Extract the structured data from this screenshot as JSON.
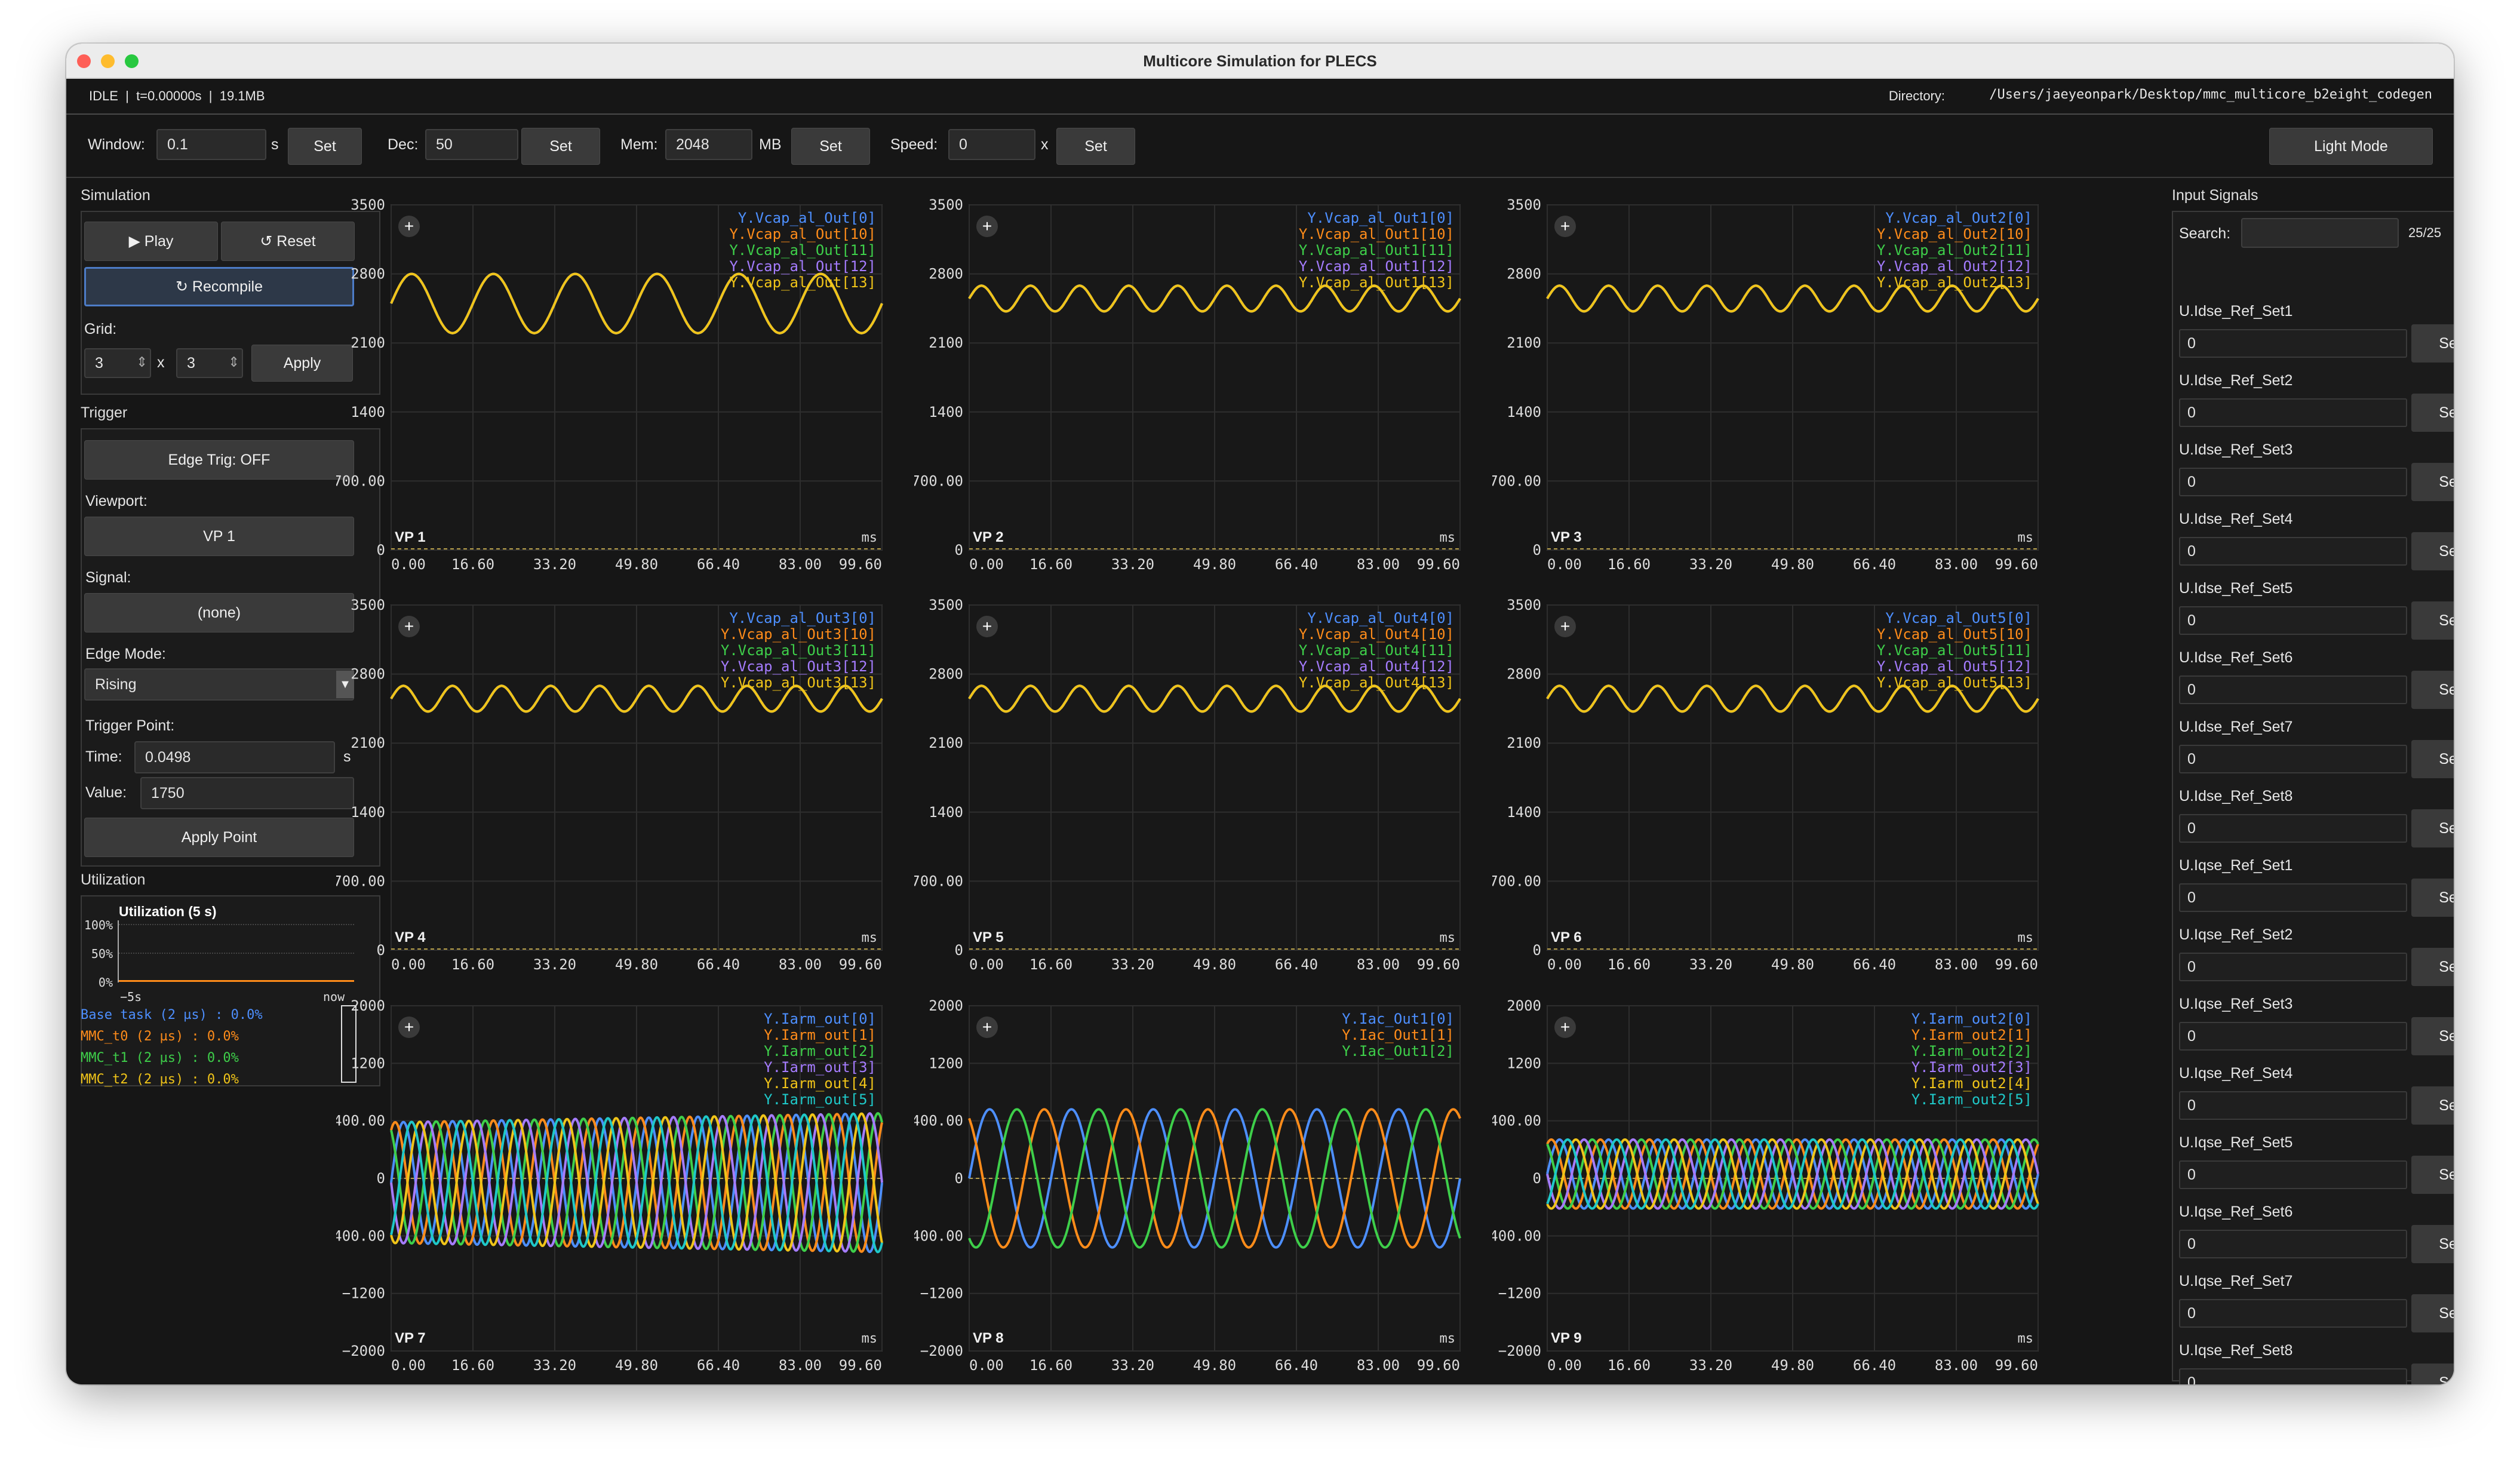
{
  "window": {
    "title": "Multicore Simulation for PLECS"
  },
  "status": {
    "text": "IDLE  |  t=0.00000s  |  19.1MB",
    "directory_label": "Directory:",
    "directory_path": "/Users/jaeyeonpark/Desktop/mmc_multicore_b2eight_codegen"
  },
  "toolbar": {
    "window_label": "Window:",
    "window_value": "0.1",
    "window_unit": "s",
    "dec_label": "Dec:",
    "dec_value": "50",
    "mem_label": "Mem:",
    "mem_value": "2048",
    "mem_unit": "MB",
    "speed_label": "Speed:",
    "speed_value": "0",
    "speed_unit": "x",
    "set_label": "Set",
    "light_mode_label": "Light Mode"
  },
  "simulation": {
    "title": "Simulation",
    "play_label": "▶  Play",
    "reset_label": "↺  Reset",
    "recompile_label": "↻  Recompile",
    "grid_label": "Grid:",
    "grid_rows": "3",
    "grid_x": "x",
    "grid_cols": "3",
    "apply_label": "Apply"
  },
  "trigger": {
    "title": "Trigger",
    "edge_trig_label": "Edge Trig: OFF",
    "viewport_label": "Viewport:",
    "viewport_value": "VP 1",
    "signal_label": "Signal:",
    "signal_value": "(none)",
    "edge_mode_label": "Edge Mode:",
    "edge_mode_value": "Rising",
    "trigger_point_label": "Trigger Point:",
    "time_label": "Time:",
    "time_value": "0.0498",
    "time_unit": "s",
    "value_label": "Value:",
    "value_value": "1750",
    "apply_point_label": "Apply Point"
  },
  "utilization": {
    "title": "Utilization",
    "chart_title": "Utilization (5 s)",
    "y_ticks": [
      "100%",
      "50%",
      "0%"
    ],
    "x_start": "−5s",
    "x_end": "now",
    "tasks": [
      {
        "label": "Base task (2 µs) : 0.0%",
        "color": "#4d8fff"
      },
      {
        "label": "MMC_t0 (2 µs) : 0.0%",
        "color": "#ff8c1a"
      },
      {
        "label": "MMC_t1 (2 µs) : 0.0%",
        "color": "#3ecf4a"
      },
      {
        "label": "MMC_t2 (2 µs) : 0.0%",
        "color": "#f0c419"
      }
    ]
  },
  "input_signals": {
    "title": "Input Signals",
    "search_label": "Search:",
    "search_value": "",
    "count": "25/25",
    "set_label": "Set",
    "items": [
      {
        "name": "U.Idse_Ref_Set1",
        "value": "0"
      },
      {
        "name": "U.Idse_Ref_Set2",
        "value": "0"
      },
      {
        "name": "U.Idse_Ref_Set3",
        "value": "0"
      },
      {
        "name": "U.Idse_Ref_Set4",
        "value": "0"
      },
      {
        "name": "U.Idse_Ref_Set5",
        "value": "0"
      },
      {
        "name": "U.Idse_Ref_Set6",
        "value": "0"
      },
      {
        "name": "U.Idse_Ref_Set7",
        "value": "0"
      },
      {
        "name": "U.Idse_Ref_Set8",
        "value": "0"
      },
      {
        "name": "U.Iqse_Ref_Set1",
        "value": "0"
      },
      {
        "name": "U.Iqse_Ref_Set2",
        "value": "0"
      },
      {
        "name": "U.Iqse_Ref_Set3",
        "value": "0"
      },
      {
        "name": "U.Iqse_Ref_Set4",
        "value": "0"
      },
      {
        "name": "U.Iqse_Ref_Set5",
        "value": "0"
      },
      {
        "name": "U.Iqse_Ref_Set6",
        "value": "0"
      },
      {
        "name": "U.Iqse_Ref_Set7",
        "value": "0"
      },
      {
        "name": "U.Iqse_Ref_Set8",
        "value": "0"
      }
    ]
  },
  "colors": {
    "blue": "#4d8fff",
    "orange": "#ff8c1a",
    "green": "#3ecf4a",
    "purple": "#a57cff",
    "yellow": "#f0c419",
    "cyan": "#1fc8c8"
  },
  "chart_data": [
    {
      "type": "line",
      "viewport": "VP 1",
      "x_unit": "ms",
      "xlim": [
        0,
        99.6
      ],
      "ylim": [
        0,
        3500
      ],
      "x_ticks": [
        "0.00",
        "16.60",
        "33.20",
        "49.80",
        "66.40",
        "83.00",
        "99.60"
      ],
      "y_ticks": [
        "3500",
        "2800",
        "2100",
        "1400",
        "700.00",
        "0"
      ],
      "series": [
        {
          "name": "Y.Vcap_al_Out[0]",
          "color": "#4d8fff",
          "center": 2500,
          "amplitude": 300,
          "cycles": 6
        },
        {
          "name": "Y.Vcap_al_Out[10]",
          "color": "#ff8c1a",
          "center": 2500,
          "amplitude": 300,
          "cycles": 6
        },
        {
          "name": "Y.Vcap_al_Out[11]",
          "color": "#3ecf4a",
          "center": 2500,
          "amplitude": 300,
          "cycles": 6
        },
        {
          "name": "Y.Vcap_al_Out[12]",
          "color": "#a57cff",
          "center": 2500,
          "amplitude": 300,
          "cycles": 6
        },
        {
          "name": "Y.Vcap_al_Out[13]",
          "color": "#f0c419",
          "center": 2500,
          "amplitude": 300,
          "cycles": 6
        }
      ]
    },
    {
      "type": "line",
      "viewport": "VP 2",
      "x_unit": "ms",
      "xlim": [
        0,
        99.6
      ],
      "ylim": [
        0,
        3500
      ],
      "x_ticks": [
        "0.00",
        "16.60",
        "33.20",
        "49.80",
        "66.40",
        "83.00",
        "99.60"
      ],
      "y_ticks": [
        "3500",
        "2800",
        "2100",
        "1400",
        "700.00",
        "0"
      ],
      "series": [
        {
          "name": "Y.Vcap_al_Out1[0]",
          "color": "#4d8fff",
          "center": 2550,
          "amplitude": 130,
          "cycles": 10
        },
        {
          "name": "Y.Vcap_al_Out1[10]",
          "color": "#ff8c1a",
          "center": 2550,
          "amplitude": 130,
          "cycles": 10
        },
        {
          "name": "Y.Vcap_al_Out1[11]",
          "color": "#3ecf4a",
          "center": 2550,
          "amplitude": 130,
          "cycles": 10
        },
        {
          "name": "Y.Vcap_al_Out1[12]",
          "color": "#a57cff",
          "center": 2550,
          "amplitude": 130,
          "cycles": 10
        },
        {
          "name": "Y.Vcap_al_Out1[13]",
          "color": "#f0c419",
          "center": 2550,
          "amplitude": 130,
          "cycles": 10
        }
      ]
    },
    {
      "type": "line",
      "viewport": "VP 3",
      "x_unit": "ms",
      "xlim": [
        0,
        99.6
      ],
      "ylim": [
        0,
        3500
      ],
      "x_ticks": [
        "0.00",
        "16.60",
        "33.20",
        "49.80",
        "66.40",
        "83.00",
        "99.60"
      ],
      "y_ticks": [
        "3500",
        "2800",
        "2100",
        "1400",
        "700.00",
        "0"
      ],
      "series": [
        {
          "name": "Y.Vcap_al_Out2[0]",
          "color": "#4d8fff",
          "center": 2550,
          "amplitude": 130,
          "cycles": 10
        },
        {
          "name": "Y.Vcap_al_Out2[10]",
          "color": "#ff8c1a",
          "center": 2550,
          "amplitude": 130,
          "cycles": 10
        },
        {
          "name": "Y.Vcap_al_Out2[11]",
          "color": "#3ecf4a",
          "center": 2550,
          "amplitude": 130,
          "cycles": 10
        },
        {
          "name": "Y.Vcap_al_Out2[12]",
          "color": "#a57cff",
          "center": 2550,
          "amplitude": 130,
          "cycles": 10
        },
        {
          "name": "Y.Vcap_al_Out2[13]",
          "color": "#f0c419",
          "center": 2550,
          "amplitude": 130,
          "cycles": 10
        }
      ]
    },
    {
      "type": "line",
      "viewport": "VP 4",
      "x_unit": "ms",
      "xlim": [
        0,
        99.6
      ],
      "ylim": [
        0,
        3500
      ],
      "x_ticks": [
        "0.00",
        "16.60",
        "33.20",
        "49.80",
        "66.40",
        "83.00",
        "99.60"
      ],
      "y_ticks": [
        "3500",
        "2800",
        "2100",
        "1400",
        "700.00",
        "0"
      ],
      "series": [
        {
          "name": "Y.Vcap_al_Out3[0]",
          "color": "#4d8fff",
          "center": 2550,
          "amplitude": 130,
          "cycles": 10
        },
        {
          "name": "Y.Vcap_al_Out3[10]",
          "color": "#ff8c1a",
          "center": 2550,
          "amplitude": 130,
          "cycles": 10
        },
        {
          "name": "Y.Vcap_al_Out3[11]",
          "color": "#3ecf4a",
          "center": 2550,
          "amplitude": 130,
          "cycles": 10
        },
        {
          "name": "Y.Vcap_al_Out3[12]",
          "color": "#a57cff",
          "center": 2550,
          "amplitude": 130,
          "cycles": 10
        },
        {
          "name": "Y.Vcap_al_Out3[13]",
          "color": "#f0c419",
          "center": 2550,
          "amplitude": 130,
          "cycles": 10
        }
      ]
    },
    {
      "type": "line",
      "viewport": "VP 5",
      "x_unit": "ms",
      "xlim": [
        0,
        99.6
      ],
      "ylim": [
        0,
        3500
      ],
      "x_ticks": [
        "0.00",
        "16.60",
        "33.20",
        "49.80",
        "66.40",
        "83.00",
        "99.60"
      ],
      "y_ticks": [
        "3500",
        "2800",
        "2100",
        "1400",
        "700.00",
        "0"
      ],
      "series": [
        {
          "name": "Y.Vcap_al_Out4[0]",
          "color": "#4d8fff",
          "center": 2550,
          "amplitude": 130,
          "cycles": 10
        },
        {
          "name": "Y.Vcap_al_Out4[10]",
          "color": "#ff8c1a",
          "center": 2550,
          "amplitude": 130,
          "cycles": 10
        },
        {
          "name": "Y.Vcap_al_Out4[11]",
          "color": "#3ecf4a",
          "center": 2550,
          "amplitude": 130,
          "cycles": 10
        },
        {
          "name": "Y.Vcap_al_Out4[12]",
          "color": "#a57cff",
          "center": 2550,
          "amplitude": 130,
          "cycles": 10
        },
        {
          "name": "Y.Vcap_al_Out4[13]",
          "color": "#f0c419",
          "center": 2550,
          "amplitude": 130,
          "cycles": 10
        }
      ]
    },
    {
      "type": "line",
      "viewport": "VP 6",
      "x_unit": "ms",
      "xlim": [
        0,
        99.6
      ],
      "ylim": [
        0,
        3500
      ],
      "x_ticks": [
        "0.00",
        "16.60",
        "33.20",
        "49.80",
        "66.40",
        "83.00",
        "99.60"
      ],
      "y_ticks": [
        "3500",
        "2800",
        "2100",
        "1400",
        "700.00",
        "0"
      ],
      "series": [
        {
          "name": "Y.Vcap_al_Out5[0]",
          "color": "#4d8fff",
          "center": 2550,
          "amplitude": 130,
          "cycles": 10
        },
        {
          "name": "Y.Vcap_al_Out5[10]",
          "color": "#ff8c1a",
          "center": 2550,
          "amplitude": 130,
          "cycles": 10
        },
        {
          "name": "Y.Vcap_al_Out5[11]",
          "color": "#3ecf4a",
          "center": 2550,
          "amplitude": 130,
          "cycles": 10
        },
        {
          "name": "Y.Vcap_al_Out5[12]",
          "color": "#a57cff",
          "center": 2550,
          "amplitude": 130,
          "cycles": 10
        },
        {
          "name": "Y.Vcap_al_Out5[13]",
          "color": "#f0c419",
          "center": 2550,
          "amplitude": 130,
          "cycles": 10
        }
      ]
    },
    {
      "type": "line",
      "viewport": "VP 7",
      "x_unit": "ms",
      "xlim": [
        0,
        99.6
      ],
      "ylim": [
        -2000,
        2000
      ],
      "x_ticks": [
        "0.00",
        "16.60",
        "33.20",
        "49.80",
        "66.40",
        "83.00",
        "99.60"
      ],
      "y_ticks": [
        "2000",
        "1200",
        "400.00",
        "0",
        "−400.00",
        "−1200",
        "−2000"
      ],
      "series": [
        {
          "name": "Y.Iarm_out[0]",
          "color": "#4d8fff",
          "center": -50,
          "amplitude": 700,
          "cycles": 10,
          "phase": 0
        },
        {
          "name": "Y.Iarm_out[1]",
          "color": "#ff8c1a",
          "center": -50,
          "amplitude": 700,
          "cycles": 10,
          "phase": 1.05
        },
        {
          "name": "Y.Iarm_out[2]",
          "color": "#3ecf4a",
          "center": -50,
          "amplitude": 700,
          "cycles": 10,
          "phase": 2.09
        },
        {
          "name": "Y.Iarm_out[3]",
          "color": "#a57cff",
          "center": -50,
          "amplitude": 700,
          "cycles": 10,
          "phase": 3.14
        },
        {
          "name": "Y.Iarm_out[4]",
          "color": "#f0c419",
          "center": -50,
          "amplitude": 700,
          "cycles": 10,
          "phase": 4.19
        },
        {
          "name": "Y.Iarm_out[5]",
          "color": "#1fc8c8",
          "center": -50,
          "amplitude": 700,
          "cycles": 10,
          "phase": 5.24
        }
      ]
    },
    {
      "type": "line",
      "viewport": "VP 8",
      "x_unit": "ms",
      "xlim": [
        0,
        99.6
      ],
      "ylim": [
        -2000,
        2000
      ],
      "x_ticks": [
        "0.00",
        "16.60",
        "33.20",
        "49.80",
        "66.40",
        "83.00",
        "99.60"
      ],
      "y_ticks": [
        "2000",
        "1200",
        "400.00",
        "0",
        "−400.00",
        "−1200",
        "−2000"
      ],
      "series": [
        {
          "name": "Y.Iac_Out1[0]",
          "color": "#4d8fff",
          "center": 0,
          "amplitude": 800,
          "cycles": 6,
          "phase": 0
        },
        {
          "name": "Y.Iac_Out1[1]",
          "color": "#ff8c1a",
          "center": 0,
          "amplitude": 800,
          "cycles": 6,
          "phase": 2.09
        },
        {
          "name": "Y.Iac_Out1[2]",
          "color": "#3ecf4a",
          "center": 0,
          "amplitude": 800,
          "cycles": 6,
          "phase": 4.19
        }
      ]
    },
    {
      "type": "line",
      "viewport": "VP 9",
      "x_unit": "ms",
      "xlim": [
        0,
        99.6
      ],
      "ylim": [
        -2000,
        2000
      ],
      "x_ticks": [
        "0.00",
        "16.60",
        "33.20",
        "49.80",
        "66.40",
        "83.00",
        "99.60"
      ],
      "y_ticks": [
        "2000",
        "1200",
        "400.00",
        "0",
        "−400.00",
        "−1200",
        "−2000"
      ],
      "series": [
        {
          "name": "Y.Iarm_out2[0]",
          "color": "#4d8fff",
          "center": 50,
          "amplitude": 400,
          "cycles": 10,
          "phase": 0
        },
        {
          "name": "Y.Iarm_out2[1]",
          "color": "#ff8c1a",
          "center": 50,
          "amplitude": 400,
          "cycles": 10,
          "phase": 1.05
        },
        {
          "name": "Y.Iarm_out2[2]",
          "color": "#3ecf4a",
          "center": 50,
          "amplitude": 400,
          "cycles": 10,
          "phase": 2.09
        },
        {
          "name": "Y.Iarm_out2[3]",
          "color": "#a57cff",
          "center": 50,
          "amplitude": 400,
          "cycles": 10,
          "phase": 3.14
        },
        {
          "name": "Y.Iarm_out2[4]",
          "color": "#f0c419",
          "center": 50,
          "amplitude": 400,
          "cycles": 10,
          "phase": 4.19
        },
        {
          "name": "Y.Iarm_out2[5]",
          "color": "#1fc8c8",
          "center": 50,
          "amplitude": 400,
          "cycles": 10,
          "phase": 5.24
        }
      ]
    }
  ]
}
